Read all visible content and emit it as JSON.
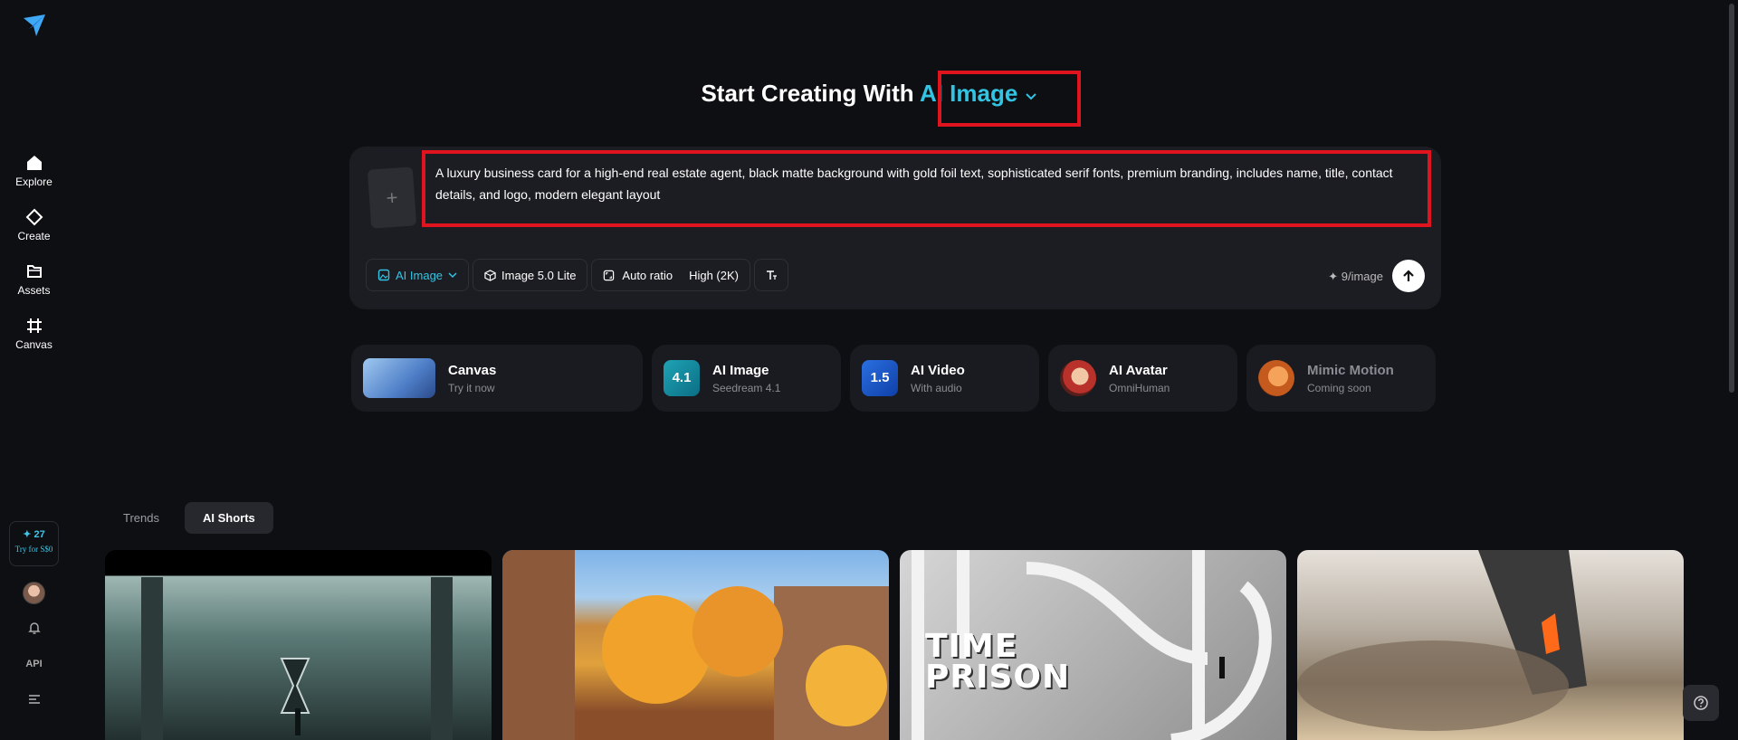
{
  "sidebar": {
    "nav": [
      {
        "label": "Explore",
        "icon": "home-icon"
      },
      {
        "label": "Create",
        "icon": "diamond-icon"
      },
      {
        "label": "Assets",
        "icon": "folder-icon"
      },
      {
        "label": "Canvas",
        "icon": "canvas-icon"
      }
    ],
    "credits": {
      "count": "✦ 27",
      "try_label": "Try for S$0"
    },
    "api_label": "API"
  },
  "hero": {
    "title_prefix": "Start Creating With",
    "mode_label": "AI Image"
  },
  "prompt": {
    "text": "A luxury business card for a high-end real estate agent, black matte background with gold foil text, sophisticated serif fonts, premium branding, includes name, title, contact details, and logo, modern elegant layout",
    "upload_symbol": "+"
  },
  "toolbar": {
    "mode_label": "AI Image",
    "model_label": "Image 5.0 Lite",
    "ratio_label": "Auto ratio",
    "quality_label": "High (2K)",
    "cost_label": "✦ 9/image"
  },
  "features": [
    {
      "title": "Canvas",
      "subtitle": "Try it now"
    },
    {
      "title": "AI Image",
      "subtitle": "Seedream 4.1",
      "badge": "4.1"
    },
    {
      "title": "AI Video",
      "subtitle": "With audio",
      "badge": "1.5"
    },
    {
      "title": "AI Avatar",
      "subtitle": "OmniHuman"
    },
    {
      "title": "Mimic Motion",
      "subtitle": "Coming soon"
    }
  ],
  "tabs": [
    {
      "label": "Trends"
    },
    {
      "label": "AI Shorts"
    }
  ],
  "gallery": {
    "thumb3_text_line1": "TIME",
    "thumb3_text_line2": "PRISON"
  },
  "colors": {
    "accent": "#33c4e4",
    "highlight": "#e0141e",
    "background": "#0e0f12"
  }
}
